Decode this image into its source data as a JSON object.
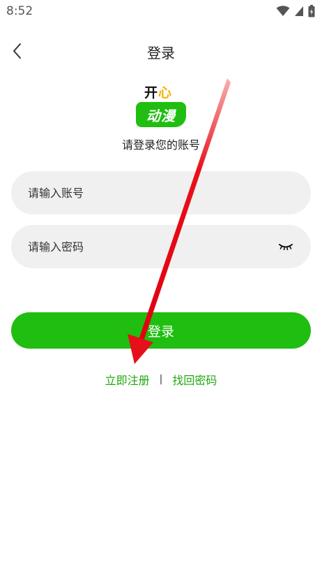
{
  "status_bar": {
    "time": "8:52"
  },
  "header": {
    "title": "登录",
    "back_icon": "chevron-left-icon"
  },
  "logo": {
    "line1_a": "开",
    "line1_b": "心",
    "line2": "动漫"
  },
  "subtitle": "请登录您的账号",
  "form": {
    "account_placeholder": "请输入账号",
    "account_value": "",
    "password_placeholder": "请输入密码",
    "password_value": "",
    "password_toggle_icon": "eye-closed-icon"
  },
  "login_button": "登录",
  "links": {
    "register": "立即注册",
    "separator": "|",
    "forgot": "找回密码"
  },
  "colors": {
    "primary_green": "#1fbe11",
    "link_green": "#1fa80f",
    "field_bg": "#f0f0f0",
    "annotation_red": "#e8101a"
  }
}
